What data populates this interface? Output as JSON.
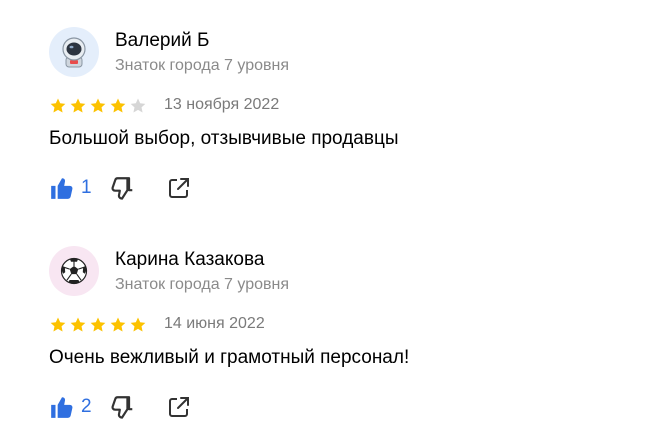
{
  "reviews": [
    {
      "author": "Валерий Б",
      "level": "Знаток города 7 уровня",
      "avatar_icon": "astronaut-icon",
      "avatar_bg": "#e4eefb",
      "rating": 4,
      "max_rating": 5,
      "date": "13 ноября 2022",
      "text": "Большой выбор, отзывчивые продавцы",
      "likes": "1"
    },
    {
      "author": "Карина Казакова",
      "level": "Знаток города 7 уровня",
      "avatar_icon": "soccer-ball-icon",
      "avatar_bg": "#f8e6f2",
      "rating": 5,
      "max_rating": 5,
      "date": "14 июня 2022",
      "text": "Очень вежливый и грамотный персонал!",
      "likes": "2"
    }
  ],
  "colors": {
    "star_filled": "#fcc200",
    "star_empty": "#d6d6d6",
    "like_accent": "#2f6fe0",
    "icon_gray": "#333333"
  }
}
